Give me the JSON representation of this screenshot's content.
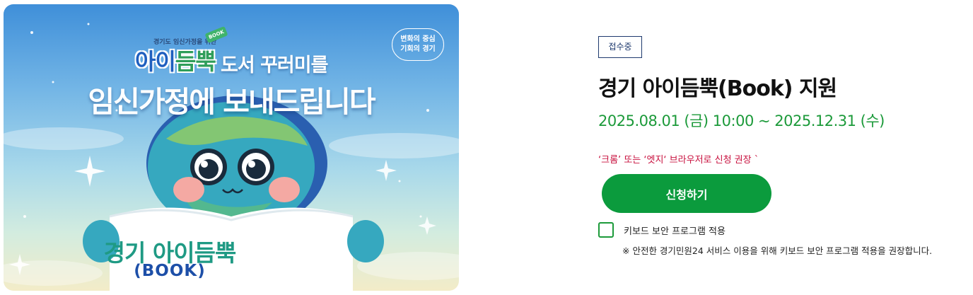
{
  "banner": {
    "brand_small": "경기도 임신가정을 위한",
    "book_tag": "BOOK",
    "brand_logo_part1": "아이",
    "brand_logo_part2": "듬뿍",
    "title_line1": "도서 꾸러미를",
    "title_line2": "임신가정에 보내드립니다",
    "slogan_line1": "변화의 중심",
    "slogan_line2": "기회의 경기",
    "book_label_line1": "경기 아이듬뿍",
    "book_label_line2": "(BOOK)"
  },
  "detail": {
    "status_badge": "접수중",
    "service_title": "경기 아이듬뿍(Book) 지원",
    "period": "2025.08.01 (금) 10:00 ~ 2025.12.31 (수)",
    "browser_notice": "‘크롬’ 또는 ‘엣지‘ 브라우저로 신청 권장 `",
    "apply_button": "신청하기",
    "keyboard_security_label": "키보드 보안 프로그램 적용",
    "keyboard_security_note": "※ 안전한 경기민원24 서비스 이용을 위해 키보드 보안 프로그램 적용을 권장합니다.",
    "keyboard_security_checked": false
  },
  "colors": {
    "accent_green": "#0b9b3d",
    "period_green": "#1c9a3a",
    "notice_red": "#c8103e",
    "badge_navy": "#1e3a6e"
  }
}
